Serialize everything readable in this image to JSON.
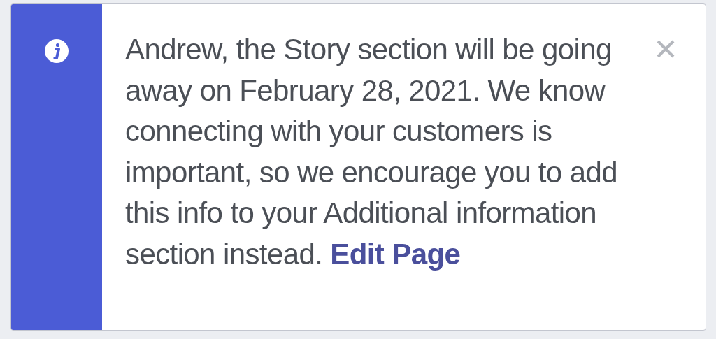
{
  "notice": {
    "message": "Andrew, the Story section will be going away on February 28, 2021. We know connecting with your customers is important, so we encourage you to add this info to your Additional information section instead.",
    "link": "Edit Page",
    "dismissible": true
  }
}
